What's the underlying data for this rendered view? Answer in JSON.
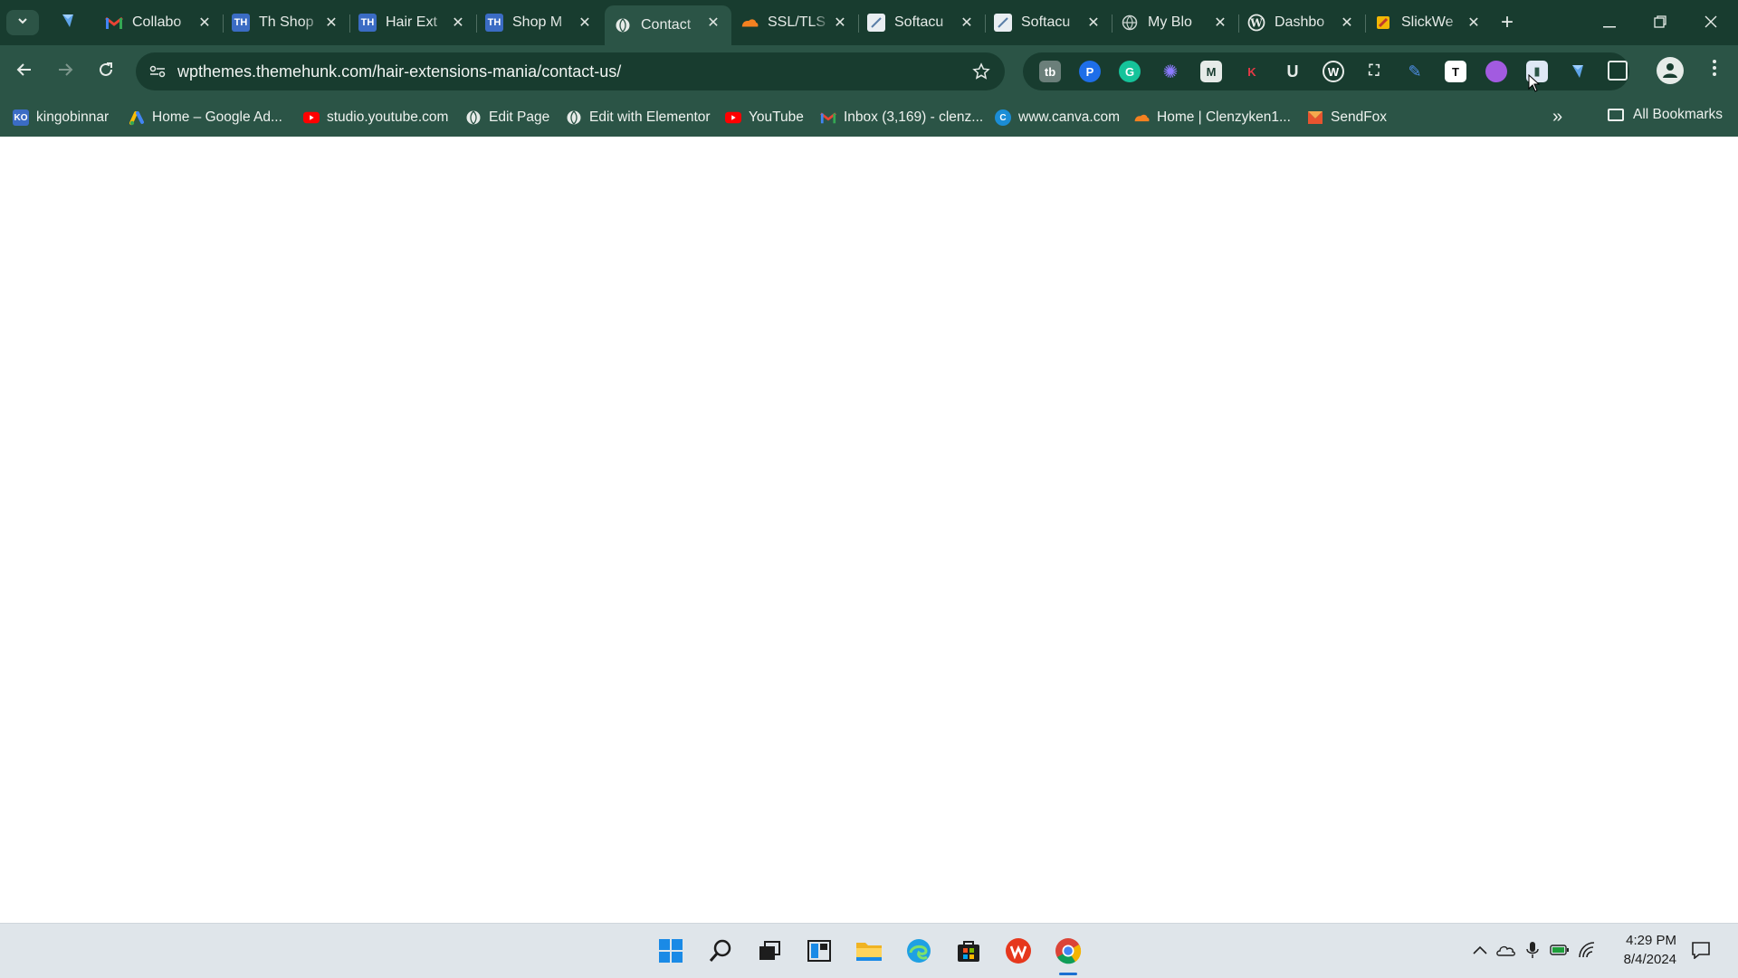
{
  "tabs": [
    {
      "title": "Collabo",
      "icon": "gmail-icon",
      "active": false
    },
    {
      "title": "Th Shop",
      "icon": "themehunk-icon",
      "active": false
    },
    {
      "title": "Hair Ext",
      "icon": "themehunk-icon",
      "active": false
    },
    {
      "title": "Shop M",
      "icon": "themehunk-icon",
      "active": false
    },
    {
      "title": "Contact",
      "icon": "globe-icon",
      "active": true
    },
    {
      "title": "SSL/TLS",
      "icon": "cloudflare-icon",
      "active": false
    },
    {
      "title": "Softacu",
      "icon": "softaculous-icon",
      "active": false
    },
    {
      "title": "Softacu",
      "icon": "softaculous-icon",
      "active": false
    },
    {
      "title": "My Blo",
      "icon": "globe-icon",
      "active": false
    },
    {
      "title": "Dashbo",
      "icon": "wordpress-icon",
      "active": false
    },
    {
      "title": "SlickWe",
      "icon": "slickwrite-icon",
      "active": false
    }
  ],
  "address_bar": {
    "url": "wpthemes.themehunk.com/hair-extensions-mania/contact-us/"
  },
  "extensions": [
    "toolbox-icon",
    "pinterest-saver-icon",
    "grammarly-icon",
    "perplexity-icon",
    "gmail-m-icon",
    "keywords-k-icon",
    "ubersuggest-icon",
    "wordpress-detector-icon",
    "screenshot-icon",
    "quill-pen-icon",
    "notion-icon",
    "loom-icon",
    "reader-icon",
    "pin-icon",
    "extensions-puzzle-icon"
  ],
  "bookmarks": [
    {
      "label": "kingobinnar",
      "icon": "ko-icon"
    },
    {
      "label": "Home – Google Ad...",
      "icon": "google-ads-icon"
    },
    {
      "label": "studio.youtube.com",
      "icon": "youtube-icon"
    },
    {
      "label": "Edit Page",
      "icon": "globe-icon"
    },
    {
      "label": "Edit with Elementor",
      "icon": "globe-icon"
    },
    {
      "label": "YouTube",
      "icon": "youtube-icon"
    },
    {
      "label": "Inbox (3,169) - clenz...",
      "icon": "gmail-icon"
    },
    {
      "label": "www.canva.com",
      "icon": "canva-icon"
    },
    {
      "label": "Home | Clenzyken1...",
      "icon": "cloudflare-icon"
    },
    {
      "label": "SendFox",
      "icon": "sendfox-icon"
    }
  ],
  "all_bookmarks_label": "All Bookmarks",
  "taskbar": {
    "apps": [
      "windows-start-icon",
      "search-icon",
      "task-view-icon",
      "widgets-icon",
      "file-explorer-icon",
      "edge-icon",
      "store-icon",
      "wps-office-icon",
      "chrome-icon"
    ],
    "time": "4:29 PM",
    "date": "8/4/2024"
  },
  "colors": {
    "chrome_dark": "#183c2f",
    "chrome_light": "#2b5446",
    "taskbar": "#dfe5ea"
  }
}
